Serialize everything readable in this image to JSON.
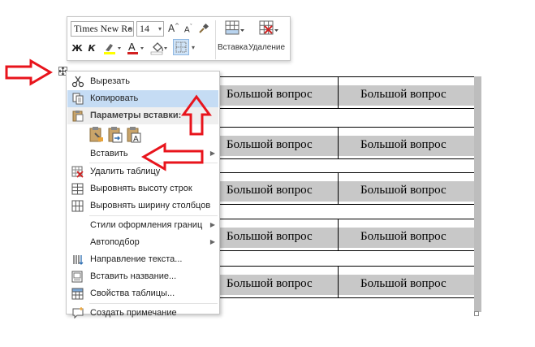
{
  "toolbar": {
    "font_name": "Times New Roı",
    "font_size": "14",
    "bold_label": "Ж",
    "italic_label": "К",
    "insert_label": "Вставка",
    "delete_label": "Удаление"
  },
  "context_menu": {
    "items": [
      {
        "label": "Вырезать",
        "icon": "scissors-icon"
      },
      {
        "label": "Копировать",
        "icon": "copy-icon"
      },
      {
        "label": "Параметры вставки:",
        "icon": "paste-options-icon"
      },
      {
        "label": "Вставить",
        "icon": "none"
      },
      {
        "label": "Удалить таблицу",
        "icon": "delete-table-icon"
      },
      {
        "label": "Выровнять высоту строк",
        "icon": "distribute-rows-icon"
      },
      {
        "label": "Выровнять ширину столбцов",
        "icon": "distribute-columns-icon"
      },
      {
        "label": "Стили оформления границ",
        "icon": "none"
      },
      {
        "label": "Автоподбор",
        "icon": "none"
      },
      {
        "label": "Направление текста...",
        "icon": "text-direction-icon"
      },
      {
        "label": "Вставить название...",
        "icon": "insert-caption-icon"
      },
      {
        "label": "Свойства таблицы...",
        "icon": "table-properties-icon"
      },
      {
        "label": "Создать примечание",
        "icon": "new-comment-icon"
      }
    ]
  },
  "table": {
    "rows": [
      [
        "Большой вопрос",
        "Большой вопрос"
      ],
      [
        "Большой вопрос",
        "Большой вопрос"
      ],
      [
        "Большой вопрос",
        "Большой вопрос"
      ],
      [
        "Большой вопрос",
        "Большой вопрос"
      ],
      [
        "Большой вопрос",
        "Большой вопрос"
      ]
    ]
  },
  "colors": {
    "annotation": "#e8141c",
    "menu_hover": "#c5dcf4",
    "cell_highlight": "#c8c8c8",
    "highlighter": "#ffff00",
    "font_color": "#d22020"
  }
}
